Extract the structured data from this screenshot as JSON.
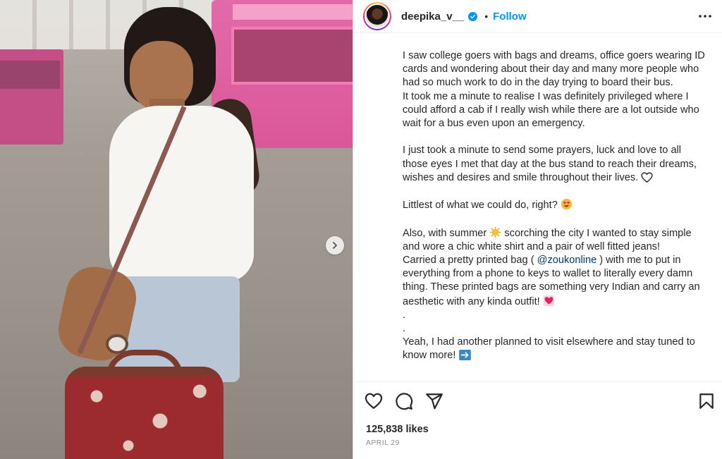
{
  "header": {
    "username": "deepika_v__",
    "separator": "•",
    "follow_label": "Follow"
  },
  "caption": {
    "p1": "I saw college goers with bags and dreams, office goers wearing ID cards and wondering about their day and many more people who had so much work to do in the day trying to board their bus.",
    "p2": "It took me a minute to realise I was definitely privileged where I could afford a cab if I really wish while there are a lot outside who wait for a bus even upon an emergency.",
    "p3": "I just took a minute to send some prayers, luck and love to all those eyes I met that day at the bus stand to reach their dreams, wishes and desires and smile throughout their lives.",
    "p4": "Littlest of what we could do, right?",
    "p5_a": "Also, with summer",
    "p5_b": "scorching the city I wanted to stay simple and wore a chic white shirt and a pair of well fitted jeans!",
    "p6_a": "Carried a pretty printed bag (",
    "p6_mention": "@zoukonline",
    "p6_b": ") with me to put in everything from a phone to keys to wallet to literally every damn thing. These printed bags are something very Indian and carry an aesthetic with any kinda outfit!",
    "dot1": ".",
    "dot2": ".",
    "p7": "Yeah, I had another planned to visit elsewhere and stay tuned to know more!"
  },
  "stats": {
    "likes": "125,838 likes",
    "date": "APRIL 29"
  },
  "icons": {
    "heart": "heart-outline",
    "comment": "comment-bubble",
    "share": "paper-plane",
    "save": "bookmark-outline",
    "more": "ellipsis-horizontal",
    "next": "chevron-right",
    "verified": "verified-badge"
  },
  "colors": {
    "accent": "#0095f6",
    "mention": "#00376b",
    "muted": "#8e8e8e",
    "text": "#262626"
  }
}
